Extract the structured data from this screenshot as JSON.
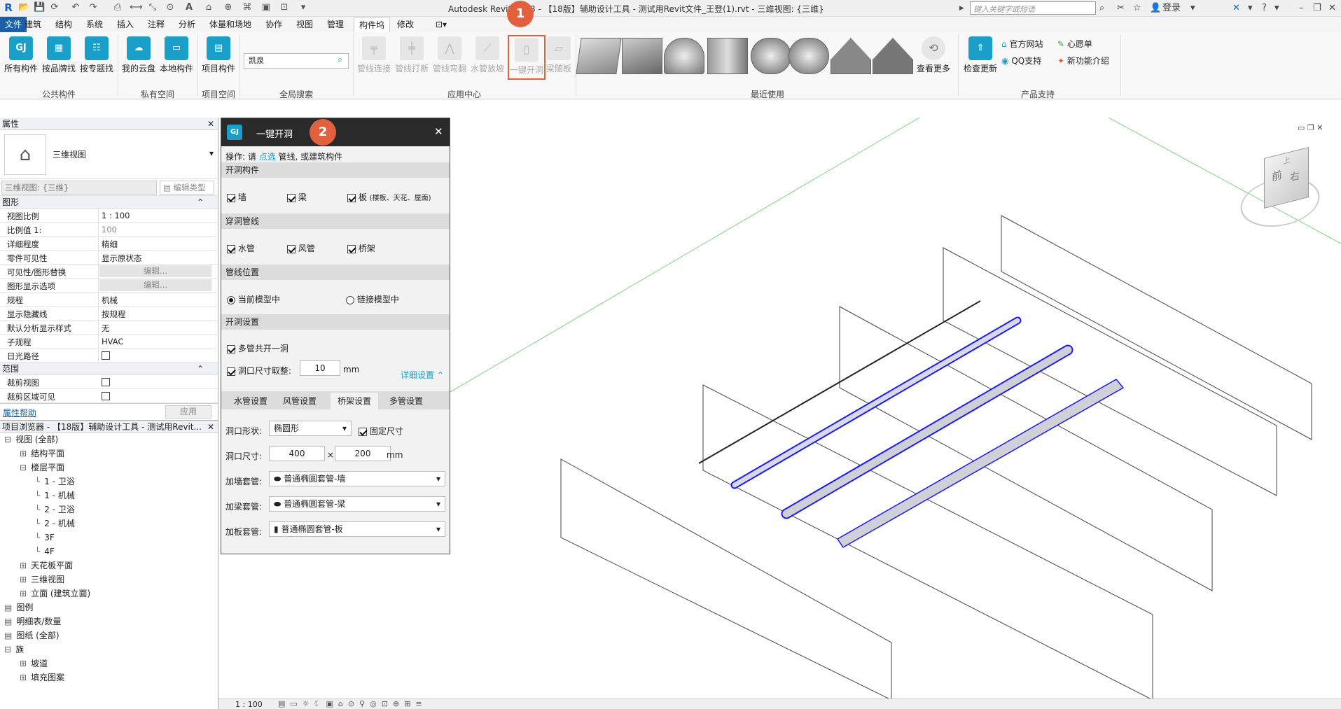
{
  "window": {
    "title": "Autodesk Revit 2018 -   【18版】辅助设计工具 - 测试用Revit文件_王登(1).rvt - 三维视图: {三维}",
    "search_placeholder": "键入关键字或短语",
    "login": "登录",
    "help": "?"
  },
  "menu": {
    "file": "文件",
    "tabs": [
      "建筑",
      "结构",
      "系统",
      "插入",
      "注释",
      "分析",
      "体量和场地",
      "协作",
      "视图",
      "管理",
      "构件坞",
      "修改"
    ]
  },
  "ribbon": {
    "public": {
      "label": "公共构件",
      "buttons": [
        "所有构件",
        "按品牌找",
        "按专题找"
      ]
    },
    "private": {
      "label": "私有空间",
      "buttons": [
        "我的云盘",
        "本地构件"
      ]
    },
    "project": {
      "label": "项目空间",
      "buttons": [
        "项目构件"
      ]
    },
    "search": {
      "label": "全局搜索",
      "value": "凯泉"
    },
    "app_center": {
      "label": "应用中心",
      "buttons": [
        "管线连接",
        "管线打断",
        "管线弯翻",
        "水管放坡",
        "一键开洞",
        "梁随板"
      ]
    },
    "recent": {
      "label": "最近使用",
      "more": "查看更多"
    },
    "support": {
      "label": "产品支持",
      "check_update": "检查更新",
      "links": [
        "官方网站",
        "心愿单",
        "QQ支持",
        "新功能介绍"
      ]
    }
  },
  "properties": {
    "header": "属性",
    "type_name": "三维视图",
    "instance": "三维视图: {三维}",
    "edit_type": "编辑类型",
    "graphics_section": "图形",
    "rows": [
      {
        "k": "视图比例",
        "v": "1 : 100"
      },
      {
        "k": "比例值 1:",
        "v": "100"
      },
      {
        "k": "详细程度",
        "v": "精细"
      },
      {
        "k": "零件可见性",
        "v": "显示原状态"
      },
      {
        "k": "可见性/图形替换",
        "v": "编辑..."
      },
      {
        "k": "图形显示选项",
        "v": "编辑..."
      },
      {
        "k": "规程",
        "v": "机械"
      },
      {
        "k": "显示隐藏线",
        "v": "按规程"
      },
      {
        "k": "默认分析显示样式",
        "v": "无"
      },
      {
        "k": "子规程",
        "v": "HVAC"
      },
      {
        "k": "日光路径",
        "v": ""
      }
    ],
    "extents_section": "范围",
    "extents_rows": [
      {
        "k": "裁剪视图",
        "v": ""
      },
      {
        "k": "裁剪区域可见",
        "v": ""
      }
    ],
    "help_link": "属性帮助",
    "apply": "应用"
  },
  "browser": {
    "header": "项目浏览器 - 【18版】辅助设计工具 - 测试用Revit...",
    "items": [
      {
        "t": "视图 (全部)",
        "lvl": 0,
        "sign": "⊟"
      },
      {
        "t": "结构平面",
        "lvl": 1,
        "sign": "⊞"
      },
      {
        "t": "楼层平面",
        "lvl": 1,
        "sign": "⊟"
      },
      {
        "t": "1 - 卫浴",
        "lvl": 2,
        "sign": ""
      },
      {
        "t": "1 - 机械",
        "lvl": 2,
        "sign": ""
      },
      {
        "t": "2 - 卫浴",
        "lvl": 2,
        "sign": ""
      },
      {
        "t": "2 - 机械",
        "lvl": 2,
        "sign": ""
      },
      {
        "t": "3F",
        "lvl": 2,
        "sign": ""
      },
      {
        "t": "4F",
        "lvl": 2,
        "sign": ""
      },
      {
        "t": "天花板平面",
        "lvl": 1,
        "sign": "⊞"
      },
      {
        "t": "三维视图",
        "lvl": 1,
        "sign": "⊞"
      },
      {
        "t": "立面 (建筑立面)",
        "lvl": 1,
        "sign": "⊞"
      },
      {
        "t": "图例",
        "lvl": 0,
        "sign": ""
      },
      {
        "t": "明细表/数量",
        "lvl": 0,
        "sign": ""
      },
      {
        "t": "图纸 (全部)",
        "lvl": 0,
        "sign": ""
      },
      {
        "t": "族",
        "lvl": 0,
        "sign": "⊟"
      },
      {
        "t": "坡道",
        "lvl": 1,
        "sign": "⊞"
      },
      {
        "t": "填充图案",
        "lvl": 1,
        "sign": "⊞"
      }
    ]
  },
  "dialog": {
    "logo": "GJ",
    "title": "一键开洞",
    "instruction_prefix": "操作: 请 ",
    "instruction_link": "点选",
    "instruction_suffix": " 管线, 或建筑构件",
    "sec_components": "开洞构件",
    "components": [
      "墙",
      "梁",
      "板"
    ],
    "board_note": "(楼板、天花、屋面)",
    "sec_pipes": "穿洞管线",
    "pipes": [
      "水管",
      "风管",
      "桥架"
    ],
    "sec_location": "管线位置",
    "loc_current": "当前模型中",
    "loc_link": "链接模型中",
    "sec_settings": "开洞设置",
    "multi_pipe": "多管共开一洞",
    "round_size": "洞口尺寸取整:",
    "round_value": "10",
    "unit": "mm",
    "detail": "详细设置",
    "tabs": [
      "水管设置",
      "风管设置",
      "桥架设置",
      "多管设置"
    ],
    "shape_label": "洞口形状:",
    "shape_value": "椭圆形",
    "fixed_size": "固定尺寸",
    "size_label": "洞口尺寸:",
    "size_w": "400",
    "size_x": "×",
    "size_h": "200",
    "wall_label": "加墙套管:",
    "wall_value": "普通椭圆套管-墙",
    "beam_label": "加梁套管:",
    "beam_value": "普通椭圆套管-梁",
    "slab_label": "加板套管:",
    "slab_value": "普通椭圆套管-板"
  },
  "markers": [
    "1",
    "2"
  ],
  "viewcube": {
    "top": "上",
    "front": "前",
    "right": "右"
  },
  "status": {
    "scale": "1 : 100"
  },
  "colors": {
    "accent": "#1aa0c8",
    "marker": "#e2603d",
    "pipe": "#1a1aff"
  }
}
